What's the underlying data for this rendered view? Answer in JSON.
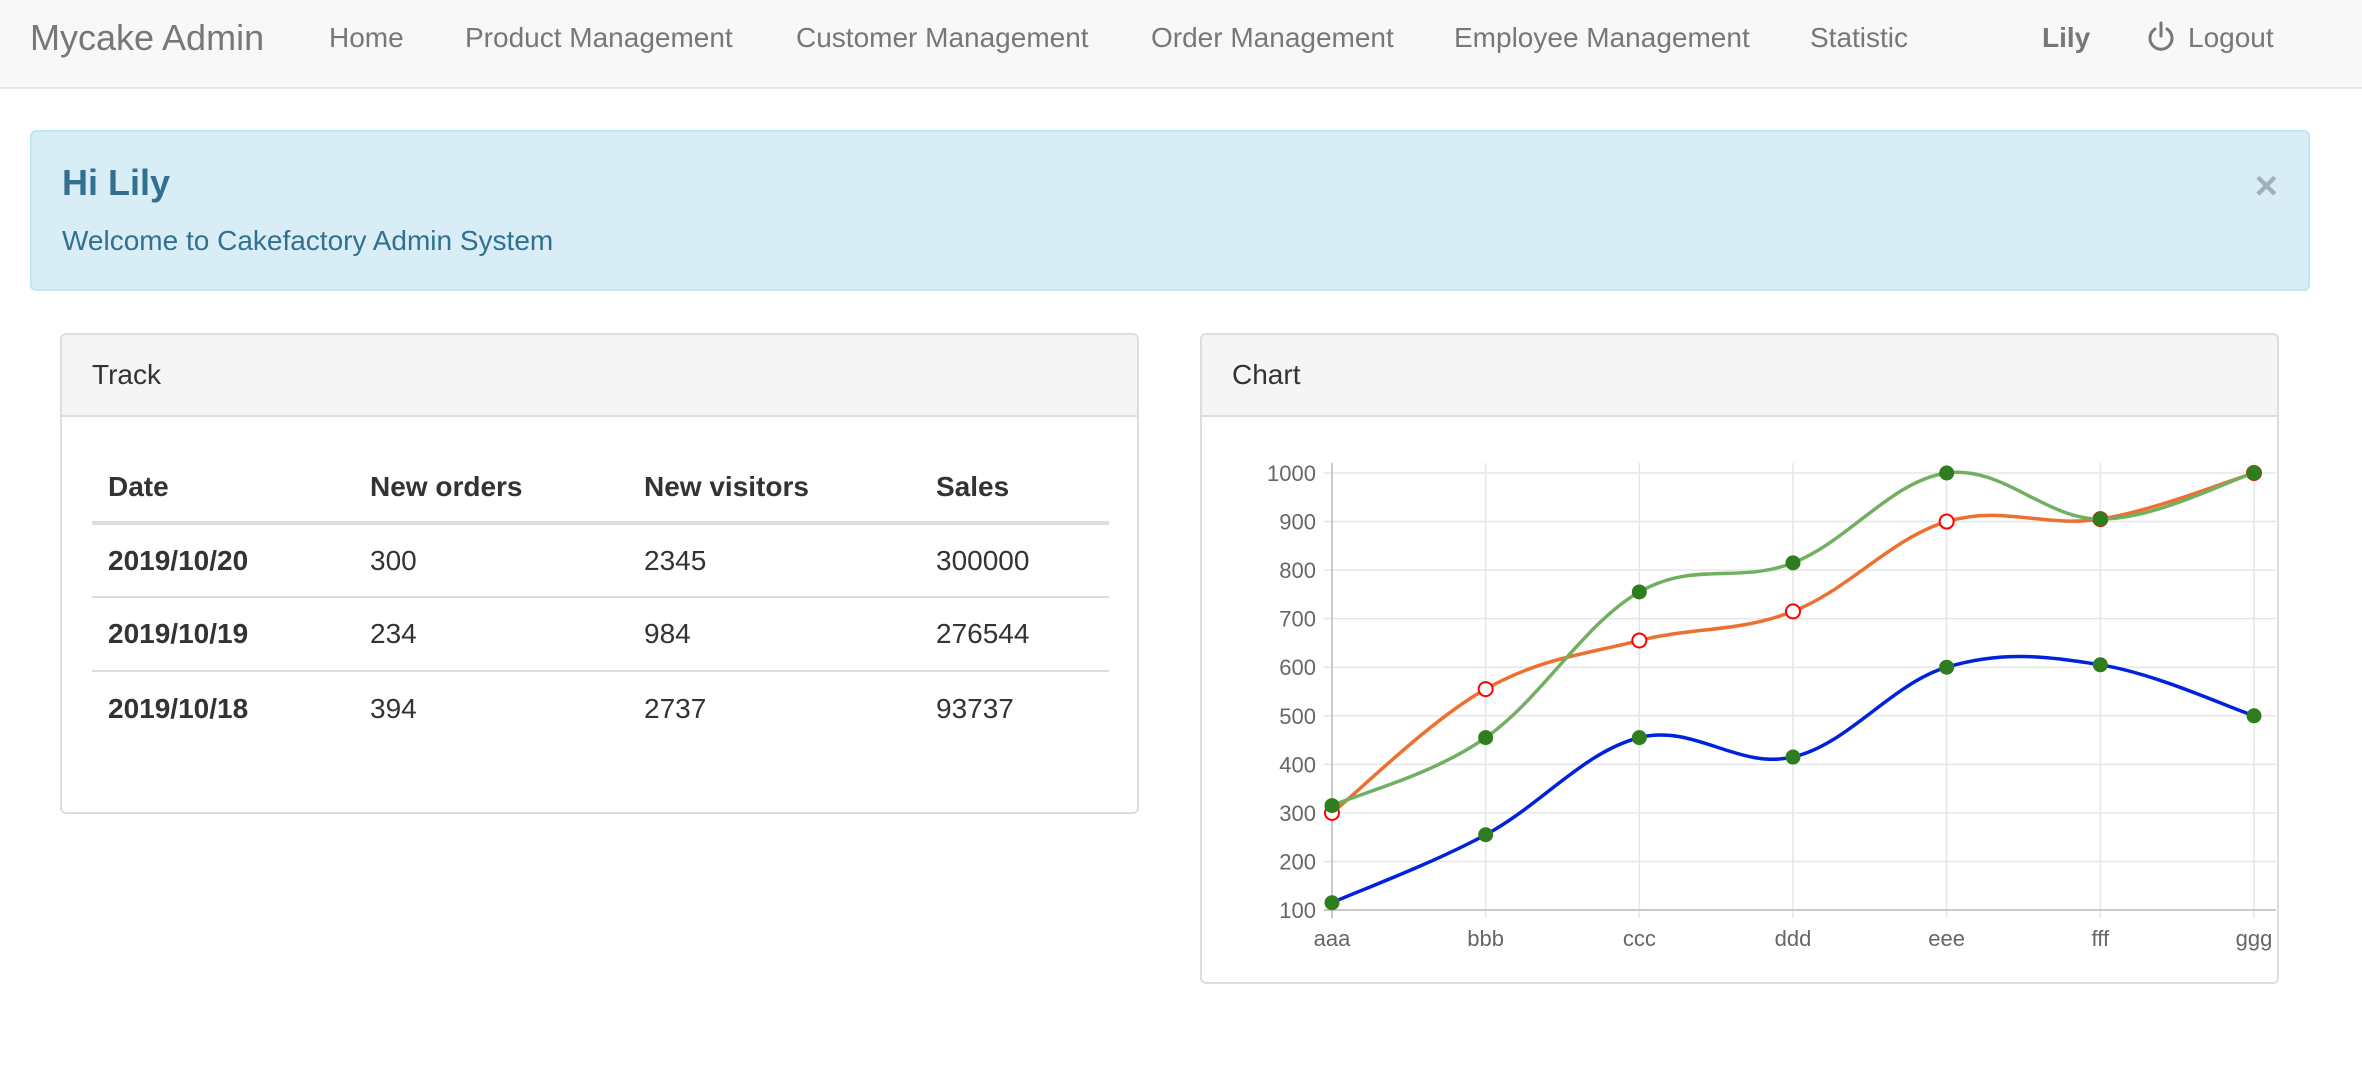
{
  "navbar": {
    "brand": "Mycake Admin",
    "links": [
      "Home",
      "Product Management",
      "Customer Management",
      "Order Management",
      "Employee Management",
      "Statistic"
    ],
    "user": "Lily",
    "logout": "Logout",
    "logout_icon": "power-icon"
  },
  "alert": {
    "title": "Hi Lily",
    "message": "Welcome to Cakefactory Admin System",
    "close": "×",
    "colors": {
      "background": "#d9edf7",
      "border": "#bce8f1",
      "text": "#31708f"
    }
  },
  "track": {
    "heading": "Track",
    "columns": [
      "Date",
      "New orders",
      "New visitors",
      "Sales"
    ],
    "rows": [
      [
        "2019/10/20",
        "300",
        "2345",
        "300000"
      ],
      [
        "2019/10/19",
        "234",
        "984",
        "276544"
      ],
      [
        "2019/10/18",
        "394",
        "2737",
        "93737"
      ]
    ]
  },
  "chart_panel": {
    "heading": "Chart"
  },
  "chart_data": {
    "type": "line",
    "categories": [
      "aaa",
      "bbb",
      "ccc",
      "ddd",
      "eee",
      "fff",
      "ggg"
    ],
    "ylim": [
      100,
      1000
    ],
    "yticks": [
      100,
      200,
      300,
      400,
      500,
      600,
      700,
      800,
      900,
      1000
    ],
    "grid": true,
    "series": [
      {
        "values": [
          300,
          555,
          655,
          715,
          900,
          905,
          1000
        ],
        "color": "#ed7031",
        "marker": "open-circle",
        "marker_color": "#ff0000"
      },
      {
        "values": [
          315,
          455,
          755,
          815,
          1000,
          905,
          1000
        ],
        "color": "#70b060",
        "marker": "filled-circle",
        "marker_color": "#2e7d1e"
      },
      {
        "values": [
          115,
          255,
          455,
          415,
          600,
          605,
          500
        ],
        "color": "#0022dd",
        "marker": "filled-circle",
        "marker_color": "#2e7d1e"
      }
    ]
  }
}
